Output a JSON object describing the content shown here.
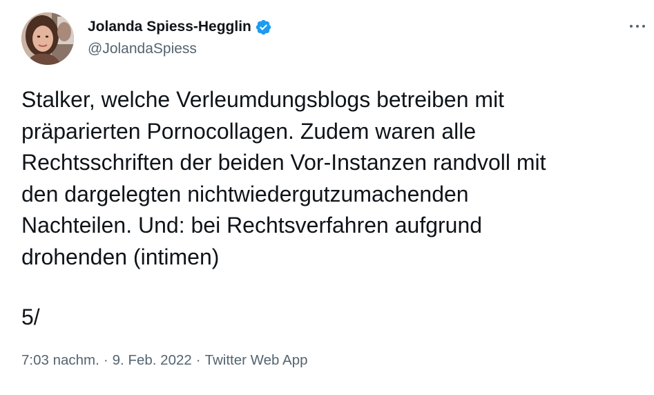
{
  "author": {
    "display_name": "Jolanda Spiess-Hegglin",
    "handle": "@JolandaSpiess",
    "verified": true,
    "verified_color": "#1d9bf0"
  },
  "tweet": {
    "lines": [
      "Stalker, welche Verleumdungsblogs betreiben mit",
      "präparierten Pornocollagen. Zudem waren alle",
      "Rechtsschriften der beiden Vor-Instanzen randvoll mit",
      "den dargelegten nichtwiedergutzumachenden",
      "Nachteilen. Und: bei Rechtsverfahren aufgrund",
      "drohenden (intimen)"
    ],
    "thread_number": "5/"
  },
  "meta": {
    "time": "7:03 nachm.",
    "separator": "·",
    "date": "9. Feb. 2022",
    "source": "Twitter Web App"
  },
  "icons": {
    "verified": "verified-badge-icon",
    "more": "more-options-icon"
  },
  "colors": {
    "text": "#0f1419",
    "secondary": "#536471",
    "verified": "#1d9bf0"
  }
}
